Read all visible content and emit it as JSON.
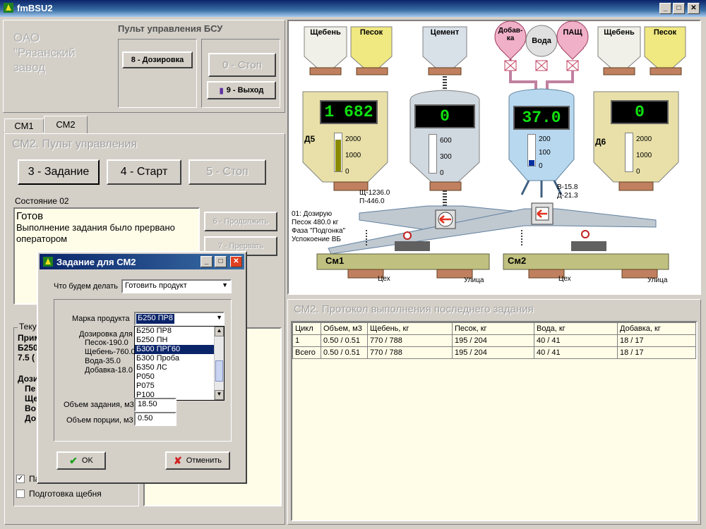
{
  "window": {
    "title": "fmBSU2"
  },
  "header": {
    "company": "ОАО\n\"Рязанский\nзавод",
    "panel_title": "Пульт управления БСУ",
    "dosing_btn": "8 - Дозировка",
    "stop_btn": "0 - Стоп",
    "exit_btn": "9 - Выход"
  },
  "tabs": [
    "СМ1",
    "СМ2"
  ],
  "control": {
    "title": "СМ2. Пульт управления",
    "task_btn": "3 - Задание",
    "start_btn": "4 - Старт",
    "stop_btn": "5 - Стоп",
    "state_label": "Состояние 02",
    "state_title": "Готов",
    "state_text": "Выполнение задания было прервано оператором",
    "continue_btn": "6 - Продолжить",
    "interrupt_btn": "7 - Прервать",
    "current_label": "Теку",
    "partial_rows": [
      "Прим",
      "Б250",
      "7.5 (",
      "Дози",
      "Пе",
      "Ще",
      "Во",
      "До"
    ],
    "check_pause": "Пауза",
    "check_crushed": "Подготовка щебня"
  },
  "dialog": {
    "title": "Задание для СМ2",
    "what_label": "Что будем делать",
    "what_value": "Готовить продукт",
    "brand_label": "Марка продукта",
    "brand_value": "Б250 ПР8",
    "dosing_label": "Дозировка для",
    "dosing_lines": [
      "Песок-190.0",
      "Щебень-760.0",
      "Вода-35.0",
      "Добавка-18.0"
    ],
    "brand_options": [
      "Б250 ПР8",
      "Б250 ПН",
      "Б300 ПРГ60",
      "Б300 Проба",
      "Б350 ЛС",
      "Р050",
      "Р075",
      "Р100"
    ],
    "selected_option": 2,
    "volume_label": "Объем задания, м3",
    "volume_value": "18.50",
    "portion_label": "Объем порции, м3",
    "portion_value": "0.50",
    "ok_btn": "OK",
    "cancel_btn": "Отменить"
  },
  "mimic": {
    "hoppers": [
      "Щебень",
      "Песок",
      "Цемент",
      "Добав-ка",
      "Вода",
      "ПАЩ",
      "Щебень",
      "Песок"
    ],
    "d5": {
      "label": "Д5",
      "value": "1 682",
      "scale": [
        "2000",
        "1000",
        "0"
      ],
      "fill": 0.84
    },
    "cement": {
      "value": "0",
      "scale": [
        "600",
        "300",
        "0"
      ],
      "fill": 0
    },
    "water": {
      "value": "37.0",
      "scale": [
        "200",
        "100",
        "0"
      ],
      "fill": 0.185
    },
    "d6": {
      "label": "Д6",
      "value": "0",
      "scale": [
        "2000",
        "1000",
        "0"
      ],
      "fill": 0
    },
    "sch": "Щ-1236.0",
    "p": "П-446.0",
    "v": "В-15.8",
    "d": "Д-21.3",
    "status_lines": [
      "01: Дозирую",
      "Песок 480.0 кг",
      "Фаза \"Подгонка\"",
      "Успокоение ВБ"
    ],
    "mixer1": "См1",
    "mixer2": "См2",
    "out1a": "Цех",
    "out1b": "Улица",
    "out2a": "Цех",
    "out2b": "Улица"
  },
  "protocol": {
    "title": "СМ2. Протокол выполнения последнего задания",
    "headers": [
      "Цикл",
      "Объем, м3",
      "Щебень, кг",
      "Песок, кг",
      "Вода, кг",
      "Добавка, кг"
    ],
    "rows": [
      [
        "1",
        "0.50 / 0.51",
        "770 / 788",
        "195 / 204",
        "40 / 41",
        "18 / 17"
      ],
      [
        "Всего",
        "0.50 / 0.51",
        "770 / 788",
        "195 / 204",
        "40 / 41",
        "18 / 17"
      ]
    ]
  },
  "colors": {
    "lcd_green": "#10e010",
    "tan": "#e8e0a0",
    "pink": "#f0b0c8",
    "cement": "#d0d8e0",
    "water": "#b8d8f0"
  }
}
